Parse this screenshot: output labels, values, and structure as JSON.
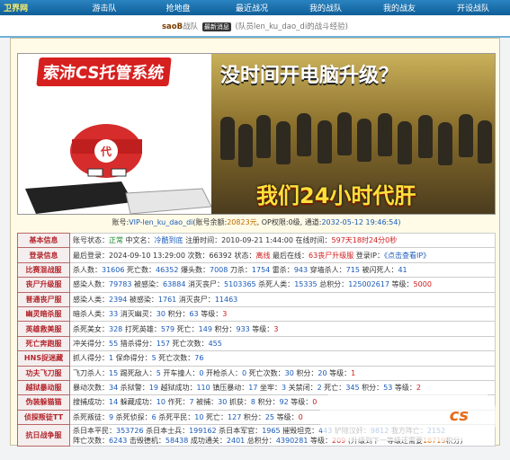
{
  "nav": {
    "brand": "卫界网",
    "items": [
      "游击队",
      "抢地盘",
      "最近战况",
      "我的战队",
      "我的战友",
      "开设战队"
    ]
  },
  "crumb": {
    "team": "saoB",
    "suffix1": "战队",
    "tag": "最新消息",
    "rest": "(队员len_ku_dao_di的战斗经验)"
  },
  "banner": {
    "system_title": "索沛CS托管系统",
    "headline": "没时间开电脑升级？",
    "subline": "我们24小时代肝"
  },
  "account": {
    "prefix": "账号:",
    "vip": "VIP-len_ku_dao_di",
    "balance_label": "(账号余额:",
    "balance": "20823元",
    "op_label": ", OP权限:",
    "op": "0级",
    "expire_label": ", 通道:",
    "expire": "2032-05-12 19:46:54)"
  },
  "rows": [
    {
      "label": "基本信息",
      "html": "账号状态：<span class='grn'>正常</span> 中文名：<span class='blue'>冷酷到底</span> 注册时间：2010-09-21 1:44:00 在线时间：<span class='red'>597天18时24分0秒</span>"
    },
    {
      "label": "登录信息",
      "html": "最后登录：2024-09-10 13:29:00 次数：66392 状态：<span class='red'>离线</span> 最后在线：<span class='red'>63丧尸升级服</span> 登录IP：<span class='blue'>《点击查看IP》</span>"
    },
    {
      "label": "比赛混战服",
      "html": "杀人数：<span class='blue'>31606</span> 死亡数：<span class='blue'>46352</span> 爆头数：<span class='blue'>7008</span> 刀杀：<span class='blue'>1754</span> 雷杀：<span class='blue'>943</span> 穿墙杀人：<span class='blue'>715</span> 被闪死人：<span class='blue'>41</span>"
    },
    {
      "label": "丧尸升级服",
      "html": "感染人数：<span class='blue'>79783</span> 被感染：<span class='blue'>63884</span> 消灭丧尸：<span class='blue'>5103365</span> 杀死人类：<span class='blue'>15335</span> 总积分：<span class='blue'>125002617</span> 等级：<span class='red'>5000</span>"
    },
    {
      "label": "普通丧尸服",
      "html": "感染人类：<span class='blue'>2394</span> 被感染：<span class='blue'>1761</span> 消灭丧尸：<span class='blue'>11463</span>"
    },
    {
      "label": "幽灵暗杀服",
      "html": "暗杀人类：<span class='blue'>33</span> 消灭幽灵：<span class='blue'>30</span> 积分：<span class='blue'>63</span> 等级：<span class='red'>3</span>"
    },
    {
      "label": "英雄救美服",
      "html": "杀死美女：<span class='blue'>328</span> 打死英雄：<span class='blue'>579</span> 死亡：<span class='blue'>149</span> 积分：<span class='blue'>933</span> 等级：<span class='red'>3</span>"
    },
    {
      "label": "死亡奔跑服",
      "html": "冲关得分：<span class='blue'>55</span> 猎杀得分：<span class='blue'>157</span> 死亡次数：<span class='blue'>455</span>"
    },
    {
      "label": "HNS捉迷藏",
      "html": "抓人得分：<span class='blue'>1</span> 保命得分：<span class='blue'>5</span> 死亡次数：<span class='blue'>76</span>"
    },
    {
      "label": "功夫飞刀服",
      "html": "飞刀杀人：<span class='blue'>15</span> 踢死敌人：<span class='blue'>5</span> 开车撞人：<span class='blue'>0</span> 开枪杀人：<span class='blue'>0</span> 死亡次数：<span class='blue'>30</span> 积分：<span class='blue'>20</span> 等级：<span class='red'>1</span>"
    },
    {
      "label": "越狱暴动服",
      "html": "暴动次数：<span class='blue'>34</span> 杀狱警：<span class='blue'>19</span> 越狱成功：<span class='blue'>110</span> 镇压暴动：<span class='blue'>17</span> 坐牢：<span class='blue'>3</span> 关禁闭：<span class='blue'>2</span> 死亡：<span class='blue'>345</span> 积分：<span class='blue'>53</span> 等级：<span class='red'>2</span>"
    },
    {
      "label": "伪装躲猫猫",
      "html": "搜捕成功：<span class='blue'>14</span> 躲藏成功：<span class='blue'>10</span> 作死：<span class='blue'>7</span> 被捕：<span class='blue'>30</span> 抓获：<span class='blue'>8</span> 积分：<span class='blue'>92</span> 等级：<span class='red'>0</span>"
    },
    {
      "label": "侦探叛徒TT",
      "html": "杀死叛徒：<span class='blue'>9</span> 杀死侦探：<span class='blue'>6</span> 杀死平民：<span class='blue'>10</span> 死亡：<span class='blue'>127</span> 积分：<span class='blue'>25</span> 等级：<span class='red'>0</span>"
    },
    {
      "label": "抗日战争服",
      "html": "杀日本平民：<span class='blue'>353726</span> 杀日本士兵：<span class='blue'>199162</span> 杀日本军官：<span class='blue'>1965</span> 摧毁坦克：<span class='blue'>443</span> 铲除汉奸：<span class='blue'>9812</span> 我方阵亡：<span class='blue'>2152</span><br>阵亡次数：<span class='blue'>6243</span> 击毁德机：<span class='blue'>58438</span> 成功通关：<span class='blue'>2401</span> 总积分：<span class='blue'>4390281</span> 等级：<span class='red'>209</span> (升级到下一等级还需要<span class='org'>18719</span>积分)"
    }
  ]
}
